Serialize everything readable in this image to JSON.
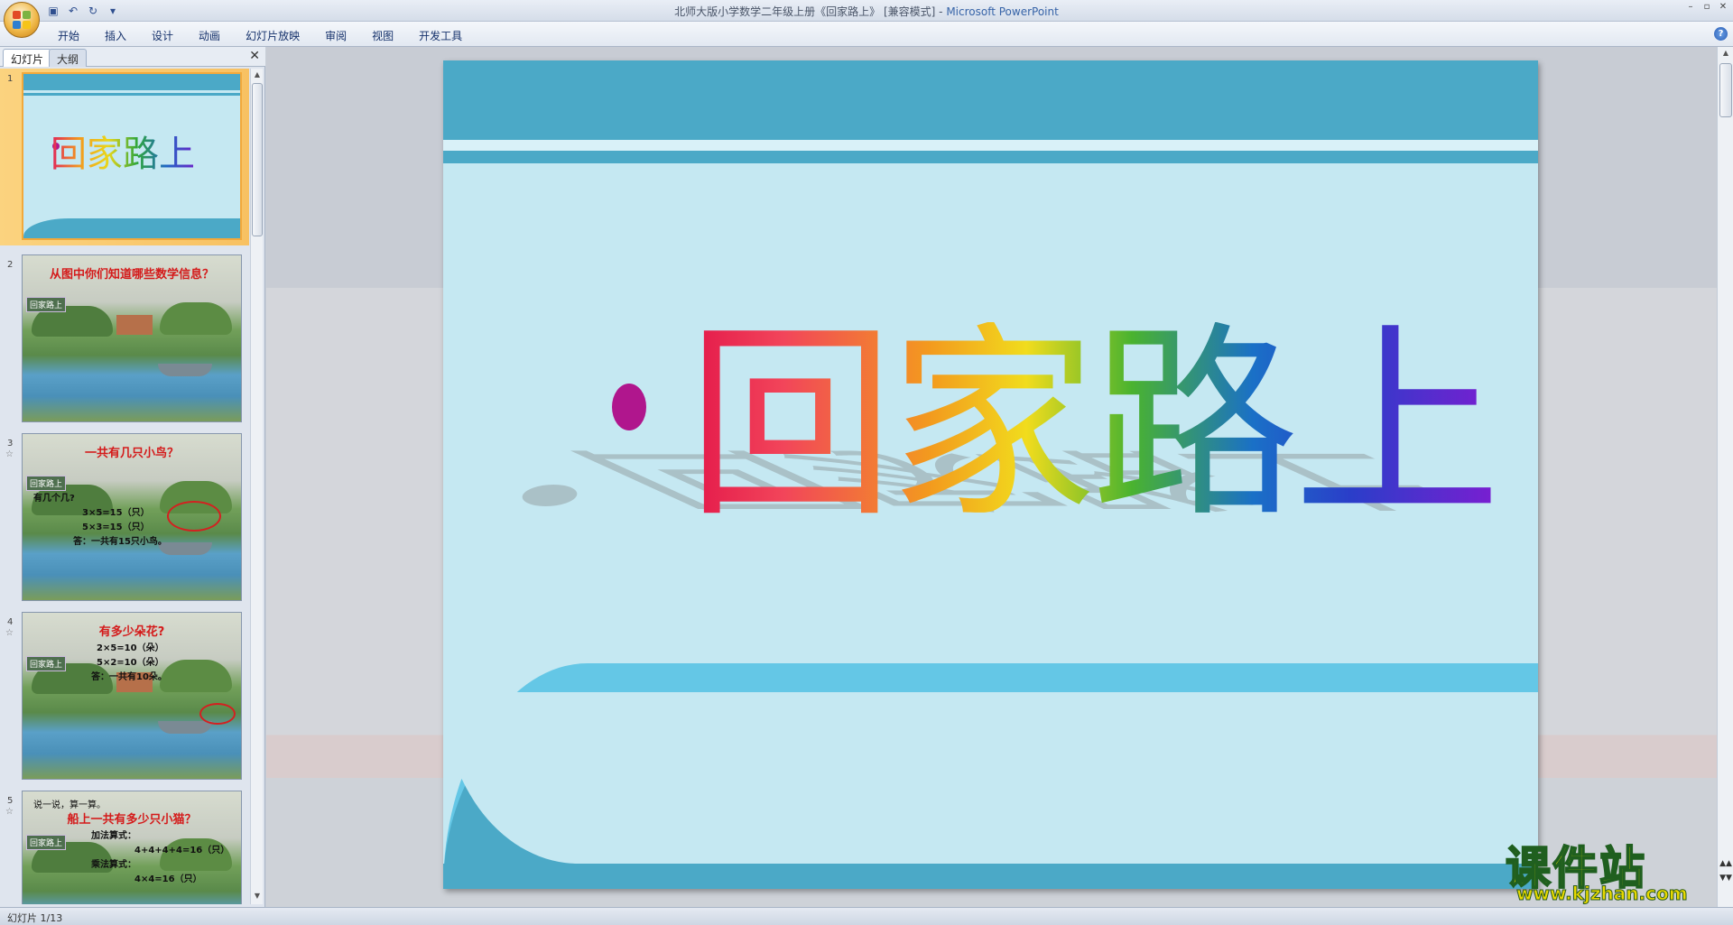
{
  "window": {
    "title": "北师大版小学数学二年级上册《回家路上》 [兼容模式] - ",
    "app_name": "Microsoft PowerPoint",
    "controls": [
      "–",
      "▫",
      "✕"
    ]
  },
  "quick_access": [
    "save-icon",
    "undo-icon",
    "redo-icon",
    "customize-icon"
  ],
  "ribbon": {
    "tabs": [
      "开始",
      "插入",
      "设计",
      "动画",
      "幻灯片放映",
      "审阅",
      "视图",
      "开发工具"
    ],
    "help": "?"
  },
  "left_pane": {
    "tabs": {
      "slides": "幻灯片",
      "outline": "大纲"
    },
    "close": "✕",
    "thumbnails": [
      {
        "num": "1",
        "title": "回家路上"
      },
      {
        "num": "2",
        "heading": "从图中你们知道哪些数学信息？",
        "tag": "回家路上"
      },
      {
        "num": "3",
        "heading": "一共有几只小鸟？",
        "tag": "回家路上",
        "lines": [
          "有几个几?",
          "3×5=15（只）",
          "5×3=15（只）",
          "答：一共有15只小鸟。"
        ],
        "highlight": "15"
      },
      {
        "num": "4",
        "heading": "有多少朵花?",
        "tag": "回家路上",
        "lines": [
          "2×5=10（朵）",
          "5×2=10（朵）",
          "答：一共有10朵。"
        ]
      },
      {
        "num": "5",
        "intro": "说一说，算一算。",
        "heading": "船上一共有多少只小猫？",
        "tag": "回家路上",
        "lines": [
          "加法算式：",
          "4+4+4+4=16（只）",
          "乘法算式：",
          "4×4=16（只）"
        ]
      }
    ],
    "star": "☆"
  },
  "slide": {
    "title": "回家路上",
    "colors": {
      "band": "#4ba9c7",
      "bg": "#c5e8f2",
      "bullet": "#b0168d"
    }
  },
  "watermark": {
    "big": "课件站",
    "small": "www.kjzhan.com"
  },
  "status": {
    "slide_info": "幻灯片 1/13"
  }
}
